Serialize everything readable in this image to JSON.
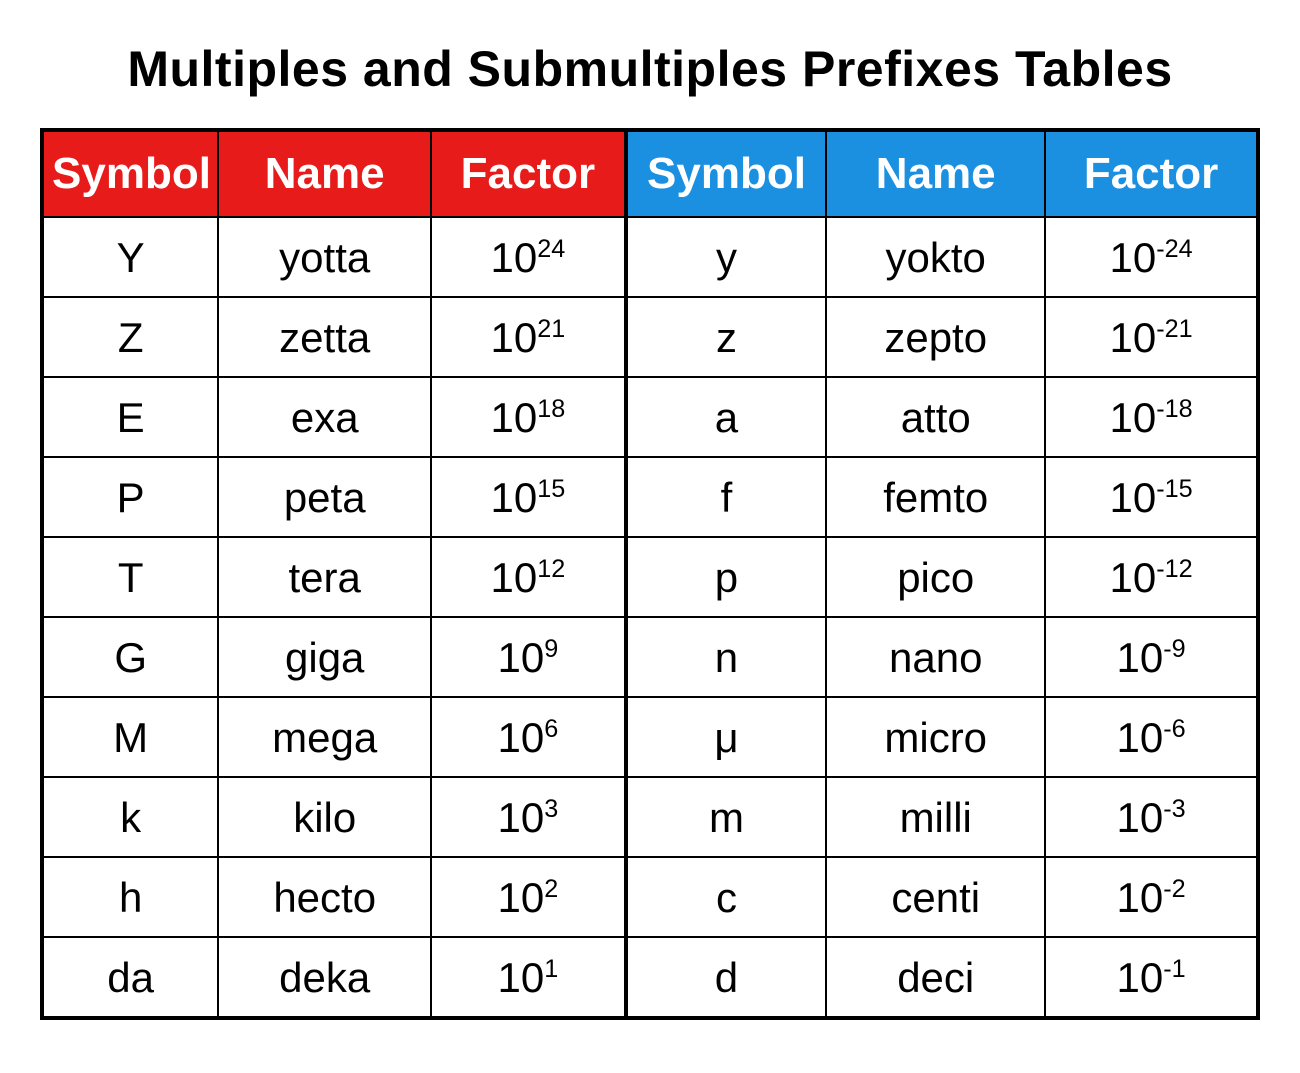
{
  "title": "Multiples and Submultiples Prefixes Tables",
  "headers": {
    "symbol": "Symbol",
    "name": "Name",
    "factor": "Factor"
  },
  "multiples": [
    {
      "symbol": "Y",
      "name": "yotta",
      "factor_base": "10",
      "factor_exp": "24"
    },
    {
      "symbol": "Z",
      "name": "zetta",
      "factor_base": "10",
      "factor_exp": "21"
    },
    {
      "symbol": "E",
      "name": "exa",
      "factor_base": "10",
      "factor_exp": "18"
    },
    {
      "symbol": "P",
      "name": "peta",
      "factor_base": "10",
      "factor_exp": "15"
    },
    {
      "symbol": "T",
      "name": "tera",
      "factor_base": "10",
      "factor_exp": "12"
    },
    {
      "symbol": "G",
      "name": "giga",
      "factor_base": "10",
      "factor_exp": "9"
    },
    {
      "symbol": "M",
      "name": "mega",
      "factor_base": "10",
      "factor_exp": "6"
    },
    {
      "symbol": "k",
      "name": "kilo",
      "factor_base": "10",
      "factor_exp": "3"
    },
    {
      "symbol": "h",
      "name": "hecto",
      "factor_base": "10",
      "factor_exp": "2"
    },
    {
      "symbol": "da",
      "name": "deka",
      "factor_base": "10",
      "factor_exp": "1"
    }
  ],
  "submultiples": [
    {
      "symbol": "y",
      "name": "yokto",
      "factor_base": "10",
      "factor_exp": "-24"
    },
    {
      "symbol": "z",
      "name": "zepto",
      "factor_base": "10",
      "factor_exp": "-21"
    },
    {
      "symbol": "a",
      "name": "atto",
      "factor_base": "10",
      "factor_exp": "-18"
    },
    {
      "symbol": "f",
      "name": "femto",
      "factor_base": "10",
      "factor_exp": "-15"
    },
    {
      "symbol": "p",
      "name": "pico",
      "factor_base": "10",
      "factor_exp": "-12"
    },
    {
      "symbol": "n",
      "name": "nano",
      "factor_base": "10",
      "factor_exp": "-9"
    },
    {
      "symbol": "μ",
      "name": "micro",
      "factor_base": "10",
      "factor_exp": "-6"
    },
    {
      "symbol": "m",
      "name": "milli",
      "factor_base": "10",
      "factor_exp": "-3"
    },
    {
      "symbol": "c",
      "name": "centi",
      "factor_base": "10",
      "factor_exp": "-2"
    },
    {
      "symbol": "d",
      "name": "deci",
      "factor_base": "10",
      "factor_exp": "-1"
    }
  ]
}
